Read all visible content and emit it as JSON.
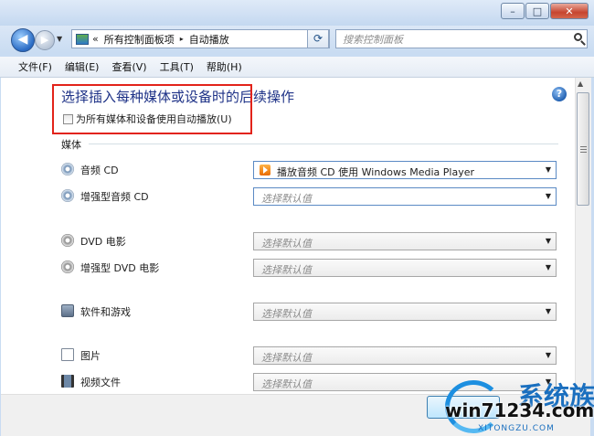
{
  "window": {
    "minimize_glyph": "–",
    "maximize_glyph": "□",
    "close_glyph": "✕"
  },
  "navigation": {
    "back_glyph": "◀",
    "forward_glyph": "▶",
    "address": {
      "chevron": "«",
      "breadcrumbs": [
        "所有控制面板项",
        "自动播放"
      ],
      "separator": "▸"
    },
    "refresh_glyph": "⟳",
    "search": {
      "placeholder": "搜索控制面板"
    }
  },
  "menubar": {
    "items": [
      "文件(F)",
      "编辑(E)",
      "查看(V)",
      "工具(T)",
      "帮助(H)"
    ]
  },
  "page": {
    "heading": "选择插入每种媒体或设备时的后续操作",
    "help_glyph": "?",
    "autoplay_checkbox": {
      "label": "为所有媒体和设备使用自动播放(U)",
      "checked": false
    },
    "section_title": "媒体"
  },
  "media_items": [
    {
      "label": "音频 CD",
      "icon": "audio-cd-icon",
      "selected": "播放音频 CD 使用 Windows Media Player",
      "has_value": true
    },
    {
      "label": "增强型音频 CD",
      "icon": "enhanced-audio-cd-icon",
      "selected": "选择默认值",
      "has_value": false
    },
    {
      "label": "DVD 电影",
      "icon": "dvd-movie-icon",
      "selected": "选择默认值",
      "has_value": false
    },
    {
      "label": "增强型 DVD 电影",
      "icon": "enhanced-dvd-movie-icon",
      "selected": "选择默认值",
      "has_value": false
    },
    {
      "label": "软件和游戏",
      "icon": "software-games-icon",
      "selected": "选择默认值",
      "has_value": false
    },
    {
      "label": "图片",
      "icon": "pictures-icon",
      "selected": "选择默认值",
      "has_value": false
    },
    {
      "label": "视频文件",
      "icon": "video-files-icon",
      "selected": "选择默认值",
      "has_value": false
    }
  ],
  "watermark": {
    "logo_text": "系统族",
    "url": "win71234.com",
    "sub": "XITONGZU.COM"
  },
  "colors": {
    "heading": "#1e3287",
    "highlight_box": "#e2231a",
    "window_chrome": "#c9dcf2"
  }
}
